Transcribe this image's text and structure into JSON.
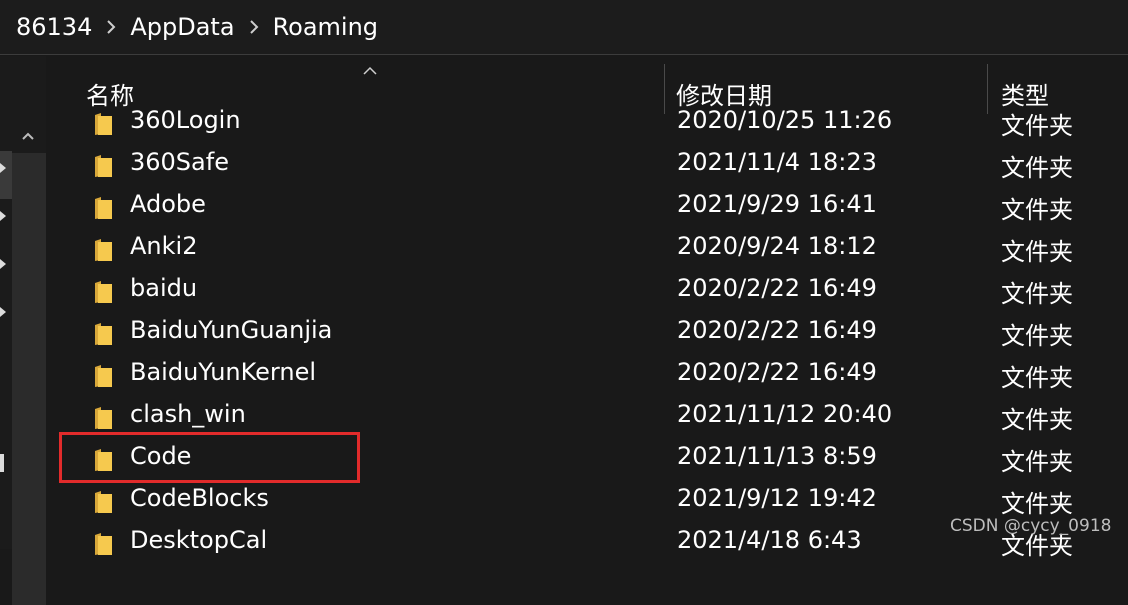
{
  "breadcrumb": {
    "items": [
      "86134",
      "AppData",
      "Roaming"
    ],
    "separator_icon": "chevron-right-icon"
  },
  "columns": {
    "name": "名称",
    "date": "修改日期",
    "type": "类型",
    "sort_icon": "sort-ascending-icon"
  },
  "files": [
    {
      "name": "360Login",
      "date": "2020/10/25 11:26",
      "type": "文件夹"
    },
    {
      "name": "360Safe",
      "date": "2021/11/4 18:23",
      "type": "文件夹"
    },
    {
      "name": "Adobe",
      "date": "2021/9/29 16:41",
      "type": "文件夹"
    },
    {
      "name": "Anki2",
      "date": "2020/9/24 18:12",
      "type": "文件夹"
    },
    {
      "name": "baidu",
      "date": "2020/2/22 16:49",
      "type": "文件夹"
    },
    {
      "name": "BaiduYunGuanjia",
      "date": "2020/2/22 16:49",
      "type": "文件夹"
    },
    {
      "name": "BaiduYunKernel",
      "date": "2020/2/22 16:49",
      "type": "文件夹"
    },
    {
      "name": "clash_win",
      "date": "2021/11/12 20:40",
      "type": "文件夹"
    },
    {
      "name": "Code",
      "date": "2021/11/13 8:59",
      "type": "文件夹"
    },
    {
      "name": "CodeBlocks",
      "date": "2021/9/12 19:42",
      "type": "文件夹"
    },
    {
      "name": "DesktopCal",
      "date": "2021/4/18 6:43",
      "type": "文件夹"
    }
  ],
  "highlighted_file": "Code",
  "watermark": "CSDN @cycy_0918",
  "colors": {
    "background": "#191919",
    "text": "#ffffff",
    "folder": "#f6c94e",
    "highlight_border": "#e22b2b"
  }
}
